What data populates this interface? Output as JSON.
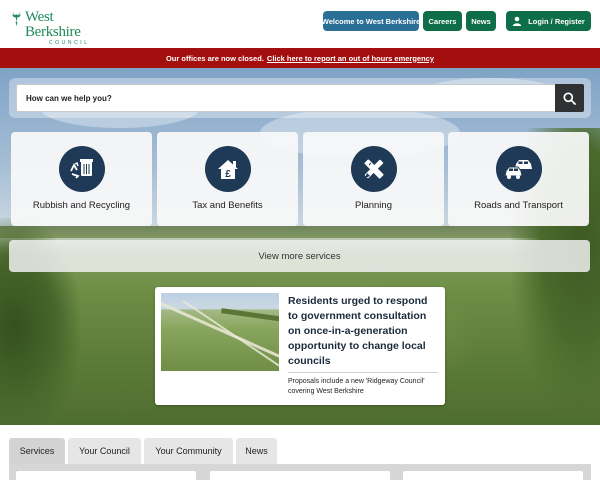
{
  "header": {
    "logo": {
      "name": "West Berkshire",
      "subtitle": "COUNCIL"
    },
    "buttons": {
      "welcome": "Welcome to West Berkshire",
      "careers": "Careers",
      "news": "News",
      "login": "Login / Register"
    }
  },
  "alert": {
    "text": "Our offices are now closed.",
    "link": "Click here to report an out of hours emergency"
  },
  "search": {
    "placeholder": "How can we help you?"
  },
  "services": [
    {
      "label": "Rubbish and Recycling",
      "icon": "recycling-bin-icon"
    },
    {
      "label": "Tax and Benefits",
      "icon": "pound-house-icon"
    },
    {
      "label": "Planning",
      "icon": "pencil-ruler-icon"
    },
    {
      "label": "Roads and Transport",
      "icon": "cars-icon"
    }
  ],
  "more_services": "View more services",
  "news": {
    "title": "Residents urged to respond to government consultation on once-in-a-generation opportunity to change local councils",
    "summary": "Proposals include a new 'Ridgeway Council' covering West Berkshire"
  },
  "tabs": [
    {
      "label": "Services",
      "active": true
    },
    {
      "label": "Your Council",
      "active": false
    },
    {
      "label": "Your Community",
      "active": false
    },
    {
      "label": "News",
      "active": false
    }
  ],
  "colors": {
    "brand_green": "#0e6e49",
    "welcome_blue": "#2a6f96",
    "alert_red": "#a30f0f",
    "icon_navy": "#1f3a56"
  }
}
